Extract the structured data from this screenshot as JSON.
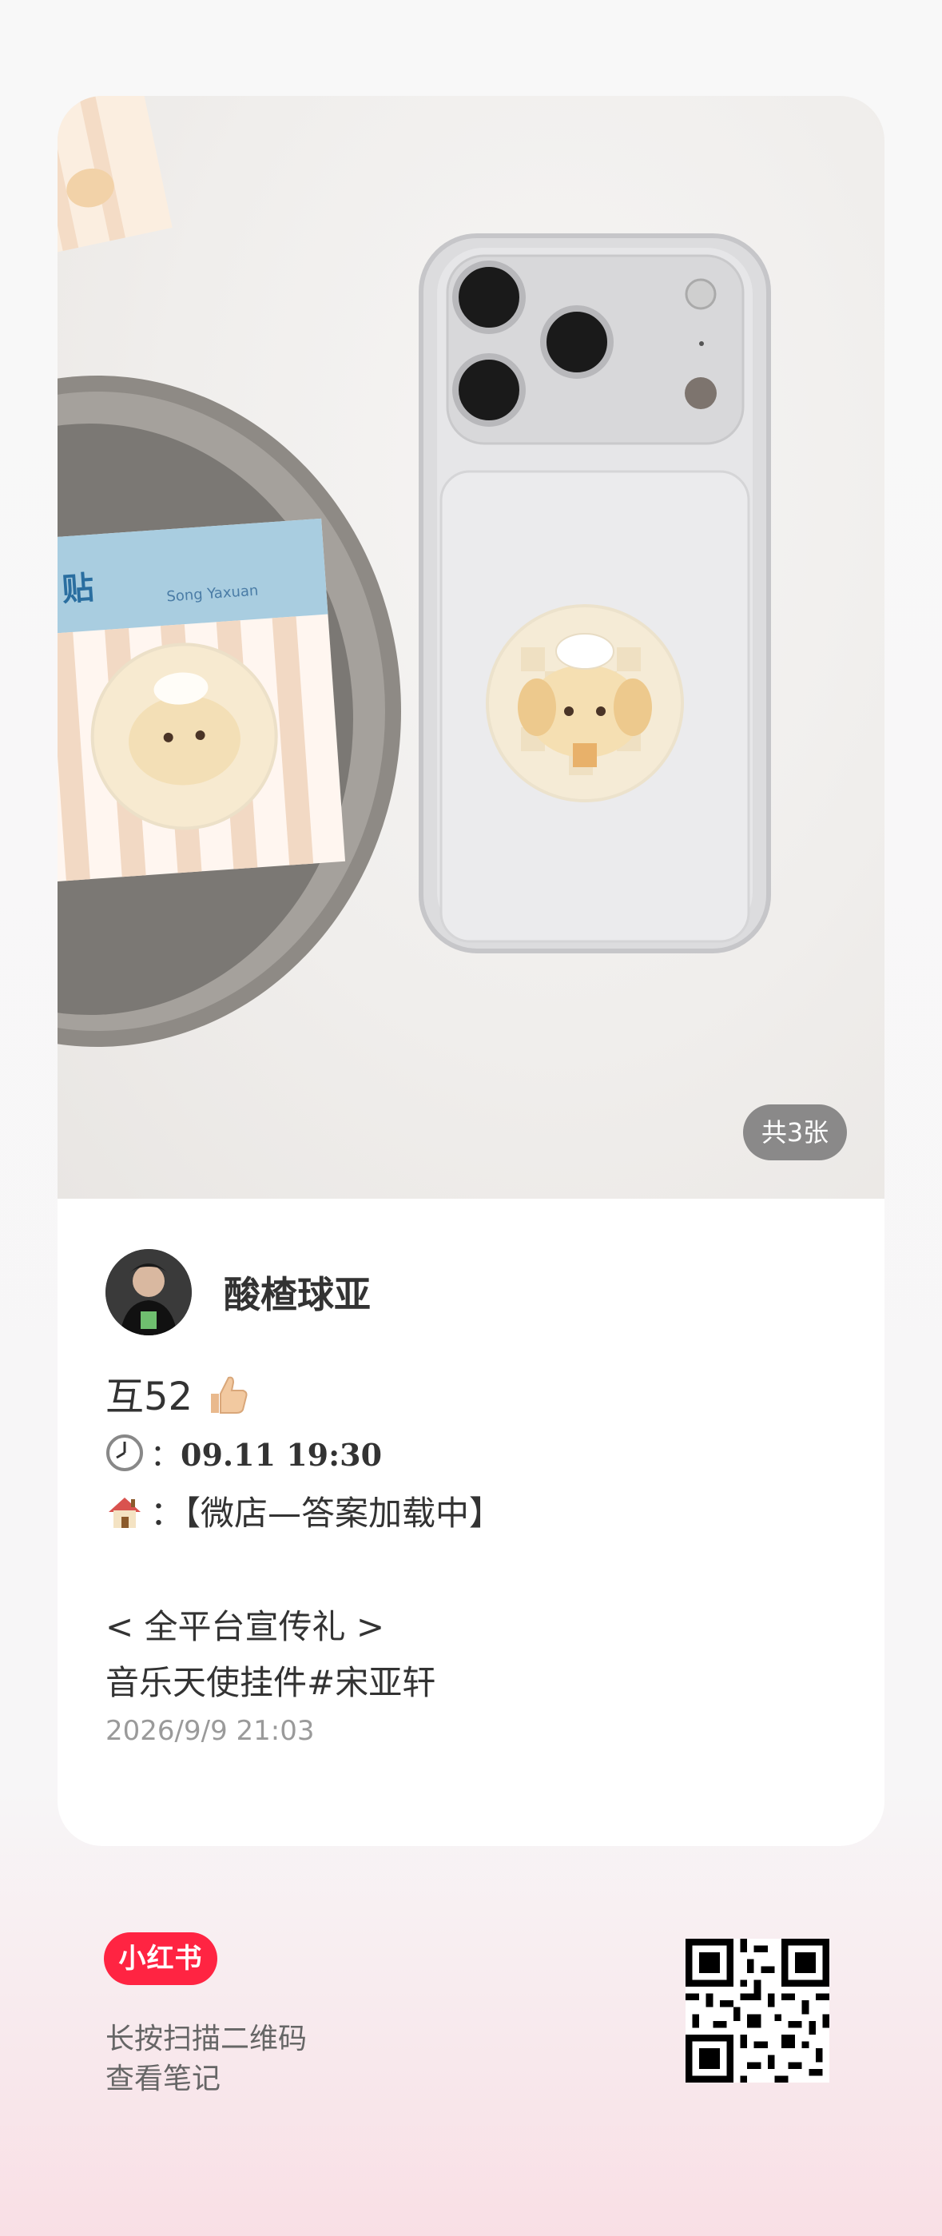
{
  "photo": {
    "count_badge": "共3张",
    "sticker_text": "Song Yaxuan",
    "sticker_title": "贴"
  },
  "author": {
    "name": "酸楂球亚"
  },
  "post": {
    "line1": "互52",
    "time_label": "：",
    "time_value": "09.11 19:30",
    "shop_label": "：",
    "shop_value": "【微店—答案加载中】",
    "promo": "< 全平台宣传礼 >",
    "tags": "音乐天使挂件#宋亚轩",
    "date": "2026/9/9 21:03"
  },
  "footer": {
    "logo": "小红书",
    "hint_line1": "长按扫描二维码",
    "hint_line2": "查看笔记"
  },
  "icons": [
    "thumbs-up-icon",
    "clock-icon",
    "house-icon",
    "qr-code-icon"
  ]
}
